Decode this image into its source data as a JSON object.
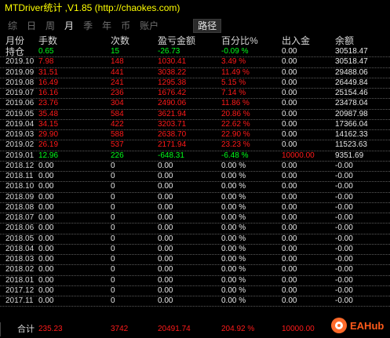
{
  "title": "MTDriver统计 ,V1.85 (http://chaokes.com)",
  "tabs": [
    {
      "label": "综",
      "active": false
    },
    {
      "label": "日",
      "active": false
    },
    {
      "label": "周",
      "active": false
    },
    {
      "label": "月",
      "active": true
    },
    {
      "label": "季",
      "active": false
    },
    {
      "label": "年",
      "active": false
    },
    {
      "label": "币",
      "active": false
    },
    {
      "label": "账户",
      "active": false
    }
  ],
  "path_tab": "路径",
  "headers": [
    "月份",
    "手数",
    "次数",
    "盈亏金额",
    "百分比%",
    "出入金",
    "余额"
  ],
  "holding_row": {
    "label": "持仓",
    "lots": "0.65",
    "count": "15",
    "pnl": "-26.73",
    "pct": "-0.09 %",
    "flow": "0.00",
    "balance": "30518.47"
  },
  "rows": [
    {
      "month": "2019.10",
      "lots": "7.98",
      "count": "148",
      "pnl": "1030.41",
      "pct": "3.49 %",
      "flow": "0.00",
      "balance": "30518.47"
    },
    {
      "month": "2019.09",
      "lots": "31.51",
      "count": "441",
      "pnl": "3038.22",
      "pct": "11.49 %",
      "flow": "0.00",
      "balance": "29488.06"
    },
    {
      "month": "2019.08",
      "lots": "16.49",
      "count": "241",
      "pnl": "1295.38",
      "pct": "5.15 %",
      "flow": "0.00",
      "balance": "26449.84"
    },
    {
      "month": "2019.07",
      "lots": "16.16",
      "count": "236",
      "pnl": "1676.42",
      "pct": "7.14 %",
      "flow": "0.00",
      "balance": "25154.46"
    },
    {
      "month": "2019.06",
      "lots": "23.76",
      "count": "304",
      "pnl": "2490.06",
      "pct": "11.86 %",
      "flow": "0.00",
      "balance": "23478.04"
    },
    {
      "month": "2019.05",
      "lots": "35.48",
      "count": "584",
      "pnl": "3621.94",
      "pct": "20.86 %",
      "flow": "0.00",
      "balance": "20987.98"
    },
    {
      "month": "2019.04",
      "lots": "34.15",
      "count": "422",
      "pnl": "3203.71",
      "pct": "22.62 %",
      "flow": "0.00",
      "balance": "17366.04"
    },
    {
      "month": "2019.03",
      "lots": "29.90",
      "count": "588",
      "pnl": "2638.70",
      "pct": "22.90 %",
      "flow": "0.00",
      "balance": "14162.33"
    },
    {
      "month": "2019.02",
      "lots": "26.19",
      "count": "537",
      "pnl": "2171.94",
      "pct": "23.23 %",
      "flow": "0.00",
      "balance": "11523.63"
    },
    {
      "month": "2019.01",
      "lots": "12.96",
      "count": "226",
      "pnl": "-648.31",
      "pct": "-6.48 %",
      "flow": "10000.00",
      "balance": "9351.69"
    },
    {
      "month": "2018.12",
      "lots": "0.00",
      "count": "0",
      "pnl": "0.00",
      "pct": "0.00 %",
      "flow": "0.00",
      "balance": "-0.00"
    },
    {
      "month": "2018.11",
      "lots": "0.00",
      "count": "0",
      "pnl": "0.00",
      "pct": "0.00 %",
      "flow": "0.00",
      "balance": "-0.00"
    },
    {
      "month": "2018.10",
      "lots": "0.00",
      "count": "0",
      "pnl": "0.00",
      "pct": "0.00 %",
      "flow": "0.00",
      "balance": "-0.00"
    },
    {
      "month": "2018.09",
      "lots": "0.00",
      "count": "0",
      "pnl": "0.00",
      "pct": "0.00 %",
      "flow": "0.00",
      "balance": "-0.00"
    },
    {
      "month": "2018.08",
      "lots": "0.00",
      "count": "0",
      "pnl": "0.00",
      "pct": "0.00 %",
      "flow": "0.00",
      "balance": "-0.00"
    },
    {
      "month": "2018.07",
      "lots": "0.00",
      "count": "0",
      "pnl": "0.00",
      "pct": "0.00 %",
      "flow": "0.00",
      "balance": "-0.00"
    },
    {
      "month": "2018.06",
      "lots": "0.00",
      "count": "0",
      "pnl": "0.00",
      "pct": "0.00 %",
      "flow": "0.00",
      "balance": "-0.00"
    },
    {
      "month": "2018.05",
      "lots": "0.00",
      "count": "0",
      "pnl": "0.00",
      "pct": "0.00 %",
      "flow": "0.00",
      "balance": "-0.00"
    },
    {
      "month": "2018.04",
      "lots": "0.00",
      "count": "0",
      "pnl": "0.00",
      "pct": "0.00 %",
      "flow": "0.00",
      "balance": "-0.00"
    },
    {
      "month": "2018.03",
      "lots": "0.00",
      "count": "0",
      "pnl": "0.00",
      "pct": "0.00 %",
      "flow": "0.00",
      "balance": "-0.00"
    },
    {
      "month": "2018.02",
      "lots": "0.00",
      "count": "0",
      "pnl": "0.00",
      "pct": "0.00 %",
      "flow": "0.00",
      "balance": "-0.00"
    },
    {
      "month": "2018.01",
      "lots": "0.00",
      "count": "0",
      "pnl": "0.00",
      "pct": "0.00 %",
      "flow": "0.00",
      "balance": "-0.00"
    },
    {
      "month": "2017.12",
      "lots": "0.00",
      "count": "0",
      "pnl": "0.00",
      "pct": "0.00 %",
      "flow": "0.00",
      "balance": "-0.00"
    },
    {
      "month": "2017.11",
      "lots": "0.00",
      "count": "0",
      "pnl": "0.00",
      "pct": "0.00 %",
      "flow": "0.00",
      "balance": "-0.00"
    }
  ],
  "total_row": {
    "label": "合计",
    "lots": "235.23",
    "count": "3742",
    "pnl": "20491.74",
    "pct": "204.92 %",
    "flow": "10000.00"
  },
  "logo_text": "EAHub",
  "colors": {
    "title": "#ffff00",
    "profit": "#ff1a1a",
    "loss": "#00ff1a",
    "neutral": "#e8e8e8",
    "background": "#000000"
  }
}
